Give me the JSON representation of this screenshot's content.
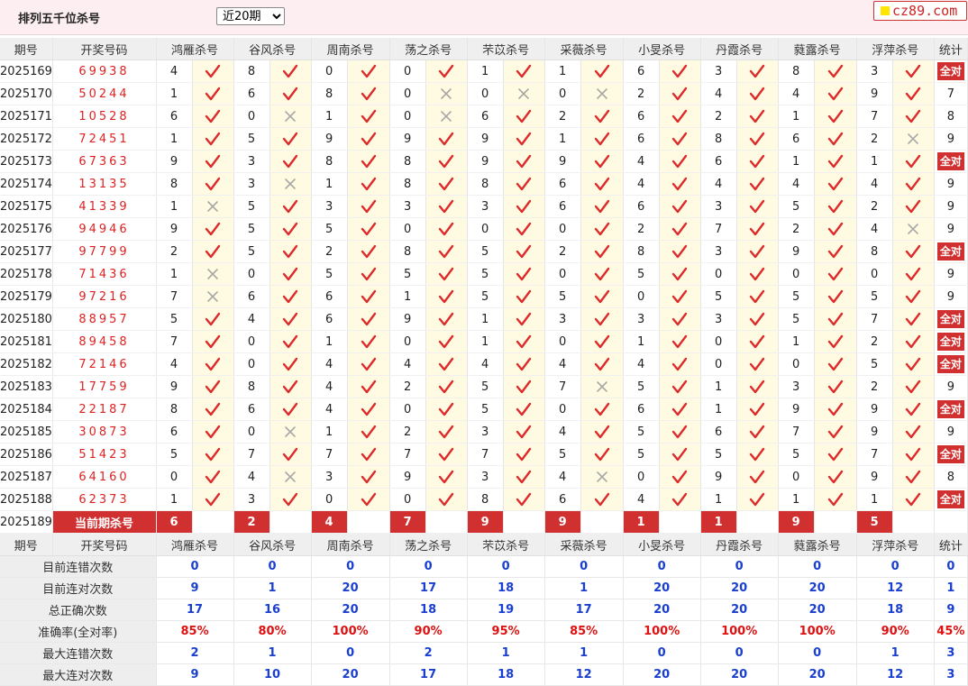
{
  "header": {
    "title": "排列五千位杀号",
    "period_select": "近20期"
  },
  "logo": {
    "text": "cz89.com"
  },
  "table": {
    "col_issue": "期号",
    "col_draw": "开奖号码",
    "experts": [
      "鸿雁杀号",
      "谷风杀号",
      "周南杀号",
      "荡之杀号",
      "芣苡杀号",
      "采薇杀号",
      "小旻杀号",
      "丹霞杀号",
      "蕤露杀号",
      "浮萍杀号"
    ],
    "col_stat": "统计",
    "rows": [
      {
        "issue": "2025169",
        "draw": "69938",
        "kills": [
          [
            4,
            1
          ],
          [
            8,
            1
          ],
          [
            0,
            1
          ],
          [
            0,
            1
          ],
          [
            1,
            1
          ],
          [
            1,
            1
          ],
          [
            6,
            1
          ],
          [
            3,
            1
          ],
          [
            8,
            1
          ],
          [
            3,
            1
          ]
        ],
        "stat": "全对"
      },
      {
        "issue": "2025170",
        "draw": "50244",
        "kills": [
          [
            1,
            1
          ],
          [
            6,
            1
          ],
          [
            8,
            1
          ],
          [
            0,
            0
          ],
          [
            0,
            0
          ],
          [
            0,
            0
          ],
          [
            2,
            1
          ],
          [
            4,
            1
          ],
          [
            4,
            1
          ],
          [
            9,
            1
          ]
        ],
        "stat": "7"
      },
      {
        "issue": "2025171",
        "draw": "10528",
        "kills": [
          [
            6,
            1
          ],
          [
            0,
            0
          ],
          [
            1,
            1
          ],
          [
            0,
            0
          ],
          [
            6,
            1
          ],
          [
            2,
            1
          ],
          [
            6,
            1
          ],
          [
            2,
            1
          ],
          [
            1,
            1
          ],
          [
            7,
            1
          ]
        ],
        "stat": "8"
      },
      {
        "issue": "2025172",
        "draw": "72451",
        "kills": [
          [
            1,
            1
          ],
          [
            5,
            1
          ],
          [
            9,
            1
          ],
          [
            9,
            1
          ],
          [
            9,
            1
          ],
          [
            1,
            1
          ],
          [
            6,
            1
          ],
          [
            8,
            1
          ],
          [
            6,
            1
          ],
          [
            2,
            0
          ]
        ],
        "stat": "9"
      },
      {
        "issue": "2025173",
        "draw": "67363",
        "kills": [
          [
            9,
            1
          ],
          [
            3,
            1
          ],
          [
            8,
            1
          ],
          [
            8,
            1
          ],
          [
            9,
            1
          ],
          [
            9,
            1
          ],
          [
            4,
            1
          ],
          [
            6,
            1
          ],
          [
            1,
            1
          ],
          [
            1,
            1
          ]
        ],
        "stat": "全对"
      },
      {
        "issue": "2025174",
        "draw": "13135",
        "kills": [
          [
            8,
            1
          ],
          [
            3,
            0
          ],
          [
            1,
            1
          ],
          [
            8,
            1
          ],
          [
            8,
            1
          ],
          [
            6,
            1
          ],
          [
            4,
            1
          ],
          [
            4,
            1
          ],
          [
            4,
            1
          ],
          [
            4,
            1
          ]
        ],
        "stat": "9"
      },
      {
        "issue": "2025175",
        "draw": "41339",
        "kills": [
          [
            1,
            0
          ],
          [
            5,
            1
          ],
          [
            3,
            1
          ],
          [
            3,
            1
          ],
          [
            3,
            1
          ],
          [
            6,
            1
          ],
          [
            6,
            1
          ],
          [
            3,
            1
          ],
          [
            5,
            1
          ],
          [
            2,
            1
          ]
        ],
        "stat": "9"
      },
      {
        "issue": "2025176",
        "draw": "94946",
        "kills": [
          [
            9,
            1
          ],
          [
            5,
            1
          ],
          [
            5,
            1
          ],
          [
            0,
            1
          ],
          [
            0,
            1
          ],
          [
            0,
            1
          ],
          [
            2,
            1
          ],
          [
            7,
            1
          ],
          [
            2,
            1
          ],
          [
            4,
            0
          ]
        ],
        "stat": "9"
      },
      {
        "issue": "2025177",
        "draw": "97799",
        "kills": [
          [
            2,
            1
          ],
          [
            5,
            1
          ],
          [
            2,
            1
          ],
          [
            8,
            1
          ],
          [
            5,
            1
          ],
          [
            2,
            1
          ],
          [
            8,
            1
          ],
          [
            3,
            1
          ],
          [
            9,
            1
          ],
          [
            8,
            1
          ]
        ],
        "stat": "全对"
      },
      {
        "issue": "2025178",
        "draw": "71436",
        "kills": [
          [
            1,
            0
          ],
          [
            0,
            1
          ],
          [
            5,
            1
          ],
          [
            5,
            1
          ],
          [
            5,
            1
          ],
          [
            0,
            1
          ],
          [
            5,
            1
          ],
          [
            0,
            1
          ],
          [
            0,
            1
          ],
          [
            0,
            1
          ]
        ],
        "stat": "9"
      },
      {
        "issue": "2025179",
        "draw": "97216",
        "kills": [
          [
            7,
            0
          ],
          [
            6,
            1
          ],
          [
            6,
            1
          ],
          [
            1,
            1
          ],
          [
            5,
            1
          ],
          [
            5,
            1
          ],
          [
            0,
            1
          ],
          [
            5,
            1
          ],
          [
            5,
            1
          ],
          [
            5,
            1
          ]
        ],
        "stat": "9"
      },
      {
        "issue": "2025180",
        "draw": "88957",
        "kills": [
          [
            5,
            1
          ],
          [
            4,
            1
          ],
          [
            6,
            1
          ],
          [
            9,
            1
          ],
          [
            1,
            1
          ],
          [
            3,
            1
          ],
          [
            3,
            1
          ],
          [
            3,
            1
          ],
          [
            5,
            1
          ],
          [
            7,
            1
          ]
        ],
        "stat": "全对"
      },
      {
        "issue": "2025181",
        "draw": "89458",
        "kills": [
          [
            7,
            1
          ],
          [
            0,
            1
          ],
          [
            1,
            1
          ],
          [
            0,
            1
          ],
          [
            1,
            1
          ],
          [
            0,
            1
          ],
          [
            1,
            1
          ],
          [
            0,
            1
          ],
          [
            1,
            1
          ],
          [
            2,
            1
          ]
        ],
        "stat": "全对"
      },
      {
        "issue": "2025182",
        "draw": "72146",
        "kills": [
          [
            4,
            1
          ],
          [
            0,
            1
          ],
          [
            4,
            1
          ],
          [
            4,
            1
          ],
          [
            4,
            1
          ],
          [
            4,
            1
          ],
          [
            4,
            1
          ],
          [
            0,
            1
          ],
          [
            0,
            1
          ],
          [
            5,
            1
          ]
        ],
        "stat": "全对"
      },
      {
        "issue": "2025183",
        "draw": "17759",
        "kills": [
          [
            9,
            1
          ],
          [
            8,
            1
          ],
          [
            4,
            1
          ],
          [
            2,
            1
          ],
          [
            5,
            1
          ],
          [
            7,
            0
          ],
          [
            5,
            1
          ],
          [
            1,
            1
          ],
          [
            3,
            1
          ],
          [
            2,
            1
          ]
        ],
        "stat": "9"
      },
      {
        "issue": "2025184",
        "draw": "22187",
        "kills": [
          [
            8,
            1
          ],
          [
            6,
            1
          ],
          [
            4,
            1
          ],
          [
            0,
            1
          ],
          [
            5,
            1
          ],
          [
            0,
            1
          ],
          [
            6,
            1
          ],
          [
            1,
            1
          ],
          [
            9,
            1
          ],
          [
            9,
            1
          ]
        ],
        "stat": "全对"
      },
      {
        "issue": "2025185",
        "draw": "30873",
        "kills": [
          [
            6,
            1
          ],
          [
            0,
            0
          ],
          [
            1,
            1
          ],
          [
            2,
            1
          ],
          [
            3,
            1
          ],
          [
            4,
            1
          ],
          [
            5,
            1
          ],
          [
            6,
            1
          ],
          [
            7,
            1
          ],
          [
            9,
            1
          ]
        ],
        "stat": "9"
      },
      {
        "issue": "2025186",
        "draw": "51423",
        "kills": [
          [
            5,
            1
          ],
          [
            7,
            1
          ],
          [
            7,
            1
          ],
          [
            7,
            1
          ],
          [
            7,
            1
          ],
          [
            5,
            1
          ],
          [
            5,
            1
          ],
          [
            5,
            1
          ],
          [
            5,
            1
          ],
          [
            7,
            1
          ]
        ],
        "stat": "全对"
      },
      {
        "issue": "2025187",
        "draw": "64160",
        "kills": [
          [
            0,
            1
          ],
          [
            4,
            0
          ],
          [
            3,
            1
          ],
          [
            9,
            1
          ],
          [
            3,
            1
          ],
          [
            4,
            0
          ],
          [
            0,
            1
          ],
          [
            9,
            1
          ],
          [
            0,
            1
          ],
          [
            9,
            1
          ]
        ],
        "stat": "8"
      },
      {
        "issue": "2025188",
        "draw": "62373",
        "kills": [
          [
            1,
            1
          ],
          [
            3,
            1
          ],
          [
            0,
            1
          ],
          [
            0,
            1
          ],
          [
            8,
            1
          ],
          [
            6,
            1
          ],
          [
            4,
            1
          ],
          [
            1,
            1
          ],
          [
            1,
            1
          ],
          [
            1,
            1
          ]
        ],
        "stat": "全对"
      }
    ],
    "current": {
      "issue": "2025189",
      "label": "当前期杀号",
      "kills": [
        "6",
        "2",
        "4",
        "7",
        "9",
        "9",
        "1",
        "1",
        "9",
        "5"
      ]
    }
  },
  "summary": {
    "rows": [
      {
        "label": "目前连错次数",
        "values": [
          "0",
          "0",
          "0",
          "0",
          "0",
          "0",
          "0",
          "0",
          "0",
          "0"
        ],
        "stat": "0",
        "red": false
      },
      {
        "label": "目前连对次数",
        "values": [
          "9",
          "1",
          "20",
          "17",
          "18",
          "1",
          "20",
          "20",
          "20",
          "12"
        ],
        "stat": "1",
        "red": false
      },
      {
        "label": "总正确次数",
        "values": [
          "17",
          "16",
          "20",
          "18",
          "19",
          "17",
          "20",
          "20",
          "20",
          "18"
        ],
        "stat": "9",
        "red": false
      },
      {
        "label": "准确率(全对率)",
        "values": [
          "85%",
          "80%",
          "100%",
          "90%",
          "95%",
          "85%",
          "100%",
          "100%",
          "100%",
          "90%"
        ],
        "stat": "45%",
        "red": true
      },
      {
        "label": "最大连错次数",
        "values": [
          "2",
          "1",
          "0",
          "2",
          "1",
          "1",
          "0",
          "0",
          "0",
          "1"
        ],
        "stat": "3",
        "red": false
      },
      {
        "label": "最大连对次数",
        "values": [
          "9",
          "10",
          "20",
          "17",
          "18",
          "12",
          "20",
          "20",
          "20",
          "12"
        ],
        "stat": "3",
        "red": false
      }
    ]
  },
  "colors": {
    "accent_red": "#d03030",
    "check_red": "#dd2b2b",
    "cross_gray": "#a8a8a8",
    "value_blue": "#1a3fd0",
    "mark_bg": "#fffbe2"
  },
  "icons": {
    "right": "check-icon",
    "wrong": "cross-icon"
  }
}
